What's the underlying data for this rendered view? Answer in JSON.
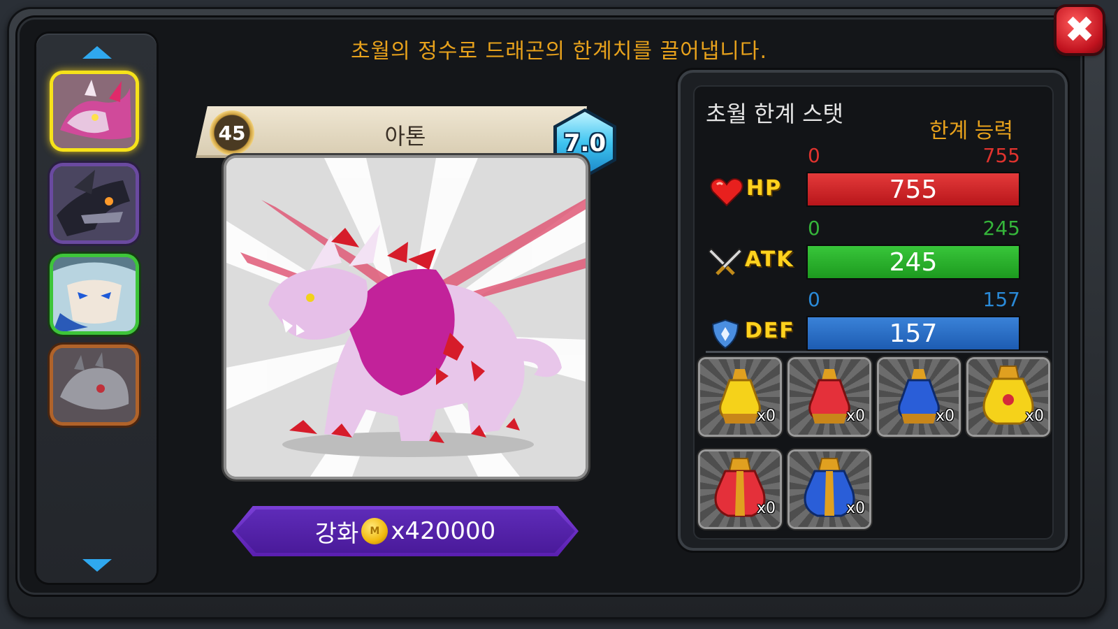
{
  "header": {
    "message": "초월의 정수로 드래곤의 한계치를 끌어냅니다."
  },
  "dragon": {
    "level": "45",
    "name": "아톤",
    "grade": "7.0"
  },
  "upgrade": {
    "label": "강화",
    "cost": "x420000",
    "coin_icon": "gold-coin-icon"
  },
  "stats": {
    "title": "초월 한계 스탯",
    "limit_label": "한계 능력",
    "hp": {
      "label": "HP",
      "min": "0",
      "max": "755",
      "value": "755",
      "fill": 1.0,
      "color": "#d42328"
    },
    "atk": {
      "label": "ATK",
      "min": "0",
      "max": "245",
      "value": "245",
      "fill": 1.0,
      "color": "#2bb02d"
    },
    "def": {
      "label": "DEF",
      "min": "0",
      "max": "157",
      "value": "157",
      "fill": 1.0,
      "color": "#2a70c8"
    }
  },
  "potions": [
    {
      "name": "yellow-potion",
      "count": "x0"
    },
    {
      "name": "red-potion",
      "count": "x0"
    },
    {
      "name": "blue-potion",
      "count": "x0"
    },
    {
      "name": "large-yellow-potion",
      "count": "x0"
    },
    {
      "name": "large-red-potion",
      "count": "x0"
    },
    {
      "name": "large-blue-potion",
      "count": "x0"
    }
  ],
  "roster": [
    "pink-dragon-portrait",
    "dark-dragon-portrait",
    "blue-beast-portrait",
    "gray-dragon-portrait"
  ],
  "colors": {
    "accent_orange": "#e8a21c",
    "stat_yellow": "#ffd21e",
    "hp_red": "#d42328",
    "atk_green": "#2bb02d",
    "def_blue": "#2a70c8"
  }
}
